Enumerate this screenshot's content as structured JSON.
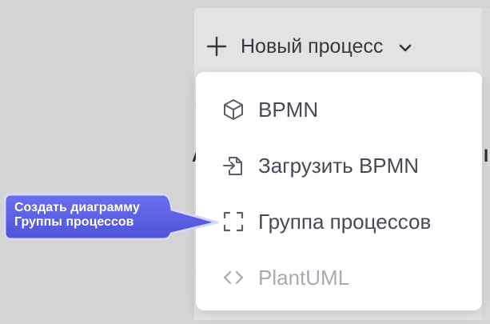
{
  "colors": {
    "overlay_bg": "#d4d4d4",
    "menu_bg": "#ffffff",
    "menu_text": "#464a54",
    "disabled_text": "#a8abb2",
    "callout_fill": "#5b5fe0",
    "callout_text": "#ffffff"
  },
  "header": {
    "new_process_label": "Новый процесс",
    "plus_icon": "plus-icon",
    "chevron_icon": "chevron-down-icon"
  },
  "menu": {
    "items": [
      {
        "label": "BPMN",
        "icon": "cube-icon",
        "enabled": true
      },
      {
        "label": "Загрузить BPMN",
        "icon": "file-import-icon",
        "enabled": true
      },
      {
        "label": "Группа процессов",
        "icon": "frame-corners-icon",
        "enabled": true
      },
      {
        "label": "PlantUML",
        "icon": "code-icon",
        "enabled": false
      }
    ]
  },
  "callout": {
    "line1": "Создать диаграмму",
    "line2": "Группы процессов"
  }
}
